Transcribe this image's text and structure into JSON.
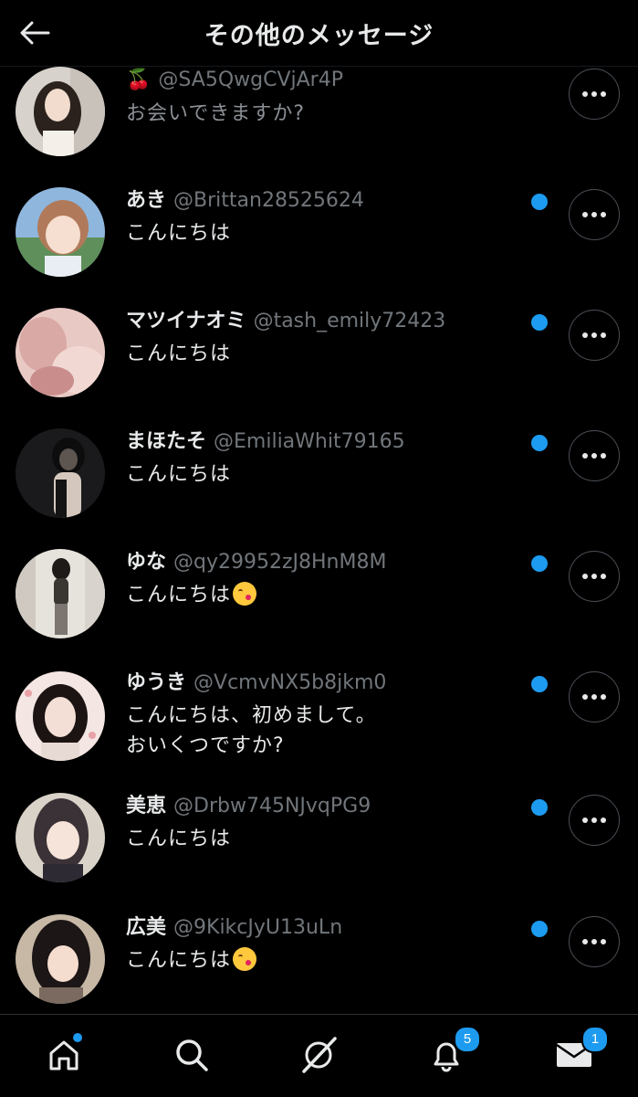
{
  "header": {
    "title": "その他のメッセージ"
  },
  "messages": [
    {
      "name": "🍒",
      "handle": "@SA5QwgCVjAr4P",
      "text": "お会いできますか?",
      "emoji": false,
      "unread": false
    },
    {
      "name": "あき",
      "handle": "@Brittan28525624",
      "text": "こんにちは",
      "emoji": false,
      "unread": true
    },
    {
      "name": "マツイナオミ",
      "handle": "@tash_emily72423",
      "text": "こんにちは",
      "emoji": false,
      "unread": true
    },
    {
      "name": "まほたそ",
      "handle": "@EmiliaWhit79165",
      "text": "こんにちは",
      "emoji": false,
      "unread": true
    },
    {
      "name": "ゆな",
      "handle": "@qy29952zJ8HnM8M",
      "text": "こんにちは",
      "emoji": true,
      "unread": true
    },
    {
      "name": "ゆうき",
      "handle": "@VcmvNX5b8jkm0",
      "text": "こんにちは、初めまして。\nおいくつですか?",
      "emoji": false,
      "unread": true
    },
    {
      "name": "美恵",
      "handle": "@Drbw745NJvqPG9",
      "text": "こんにちは",
      "emoji": false,
      "unread": true
    },
    {
      "name": "広美",
      "handle": "@9KikcJyU13uLn",
      "text": "こんにちは",
      "emoji": true,
      "unread": true
    }
  ],
  "tabbar": {
    "notifications_badge": "5",
    "messages_badge": "1"
  },
  "colors": {
    "accent": "#1d9bf0",
    "background": "#000000",
    "secondary_text": "#71767b"
  },
  "icons": [
    "back-arrow-icon",
    "more-icon",
    "home-icon",
    "search-icon",
    "spaces-icon",
    "bell-icon",
    "mail-icon"
  ]
}
